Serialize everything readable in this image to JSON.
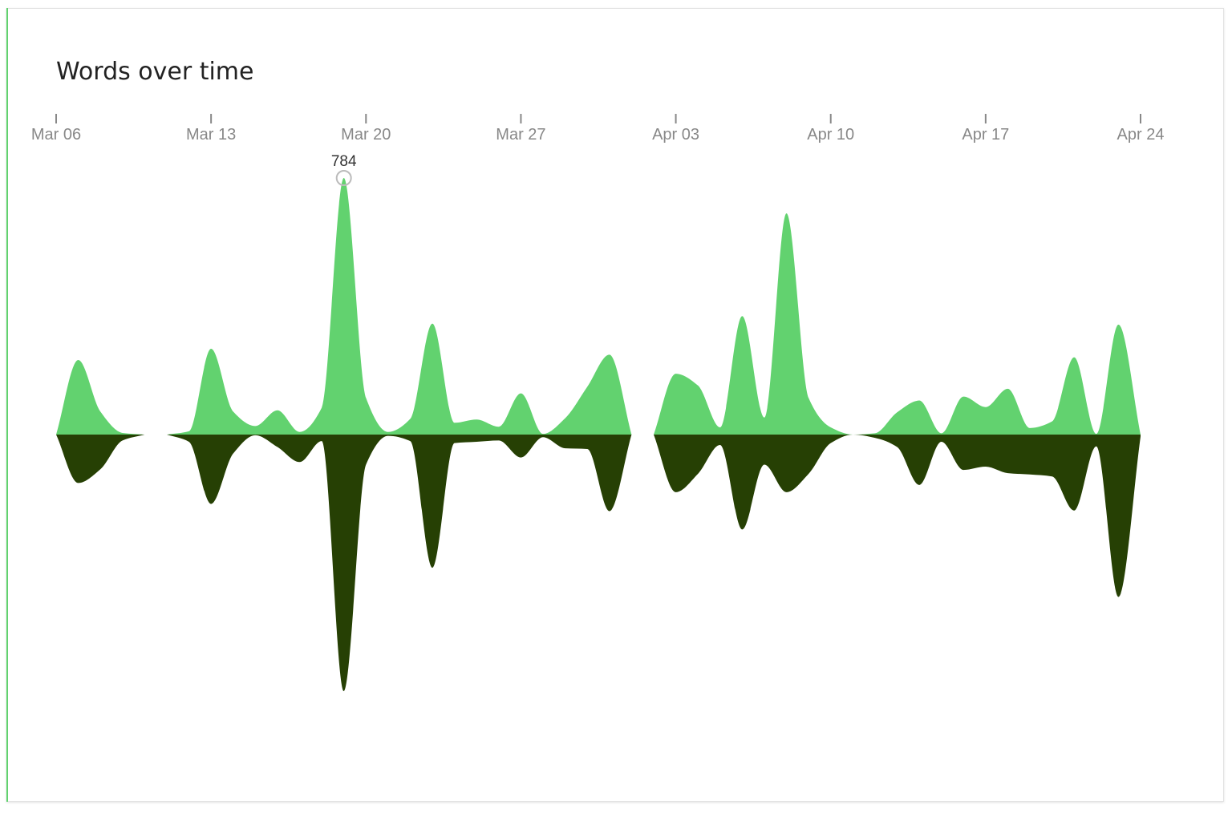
{
  "card": {
    "title": "Words over time"
  },
  "colors": {
    "upper": "#62d26f",
    "lower": "#264004",
    "tick": "#888888",
    "marker": "#bbbbbb"
  },
  "chart_data": {
    "type": "area",
    "title": "Words over time",
    "xlabel": "",
    "ylabel": "",
    "x_axis_position": "top",
    "mirrored": true,
    "grid": false,
    "legend": "none",
    "x_range": [
      "2017-03-06",
      "2017-04-24"
    ],
    "y_range": [
      -800,
      800
    ],
    "x_ticks": [
      {
        "date": "2017-03-06",
        "label": "Mar 06"
      },
      {
        "date": "2017-03-13",
        "label": "Mar 13"
      },
      {
        "date": "2017-03-20",
        "label": "Mar 20"
      },
      {
        "date": "2017-03-27",
        "label": "Mar 27"
      },
      {
        "date": "2017-04-03",
        "label": "Apr 03"
      },
      {
        "date": "2017-04-10",
        "label": "Apr 10"
      },
      {
        "date": "2017-04-17",
        "label": "Apr 17"
      },
      {
        "date": "2017-04-24",
        "label": "Apr 24"
      }
    ],
    "highlight": {
      "date": "2017-03-19",
      "value": 784,
      "label": "784"
    },
    "segments": [
      {
        "upper": [
          [
            "2017-03-06",
            0
          ],
          [
            "2017-03-07",
            228
          ],
          [
            "2017-03-08",
            70
          ],
          [
            "2017-03-09",
            5
          ],
          [
            "2017-03-10",
            0
          ]
        ],
        "lower": [
          [
            "2017-03-06",
            0
          ],
          [
            "2017-03-07",
            148
          ],
          [
            "2017-03-08",
            106
          ],
          [
            "2017-03-09",
            18
          ],
          [
            "2017-03-10",
            0
          ]
        ]
      },
      {
        "upper": [
          [
            "2017-03-11",
            0
          ],
          [
            "2017-03-12",
            10
          ],
          [
            "2017-03-13",
            262
          ],
          [
            "2017-03-14",
            70
          ],
          [
            "2017-03-15",
            26
          ],
          [
            "2017-03-16",
            74
          ],
          [
            "2017-03-17",
            8
          ],
          [
            "2017-03-18",
            82
          ],
          [
            "2017-03-19",
            784
          ],
          [
            "2017-03-20",
            112
          ],
          [
            "2017-03-21",
            8
          ],
          [
            "2017-03-22",
            48
          ],
          [
            "2017-03-23",
            339
          ],
          [
            "2017-03-24",
            36
          ],
          [
            "2017-03-25",
            46
          ],
          [
            "2017-03-26",
            24
          ],
          [
            "2017-03-27",
            126
          ],
          [
            "2017-03-28",
            2
          ],
          [
            "2017-03-29",
            50
          ],
          [
            "2017-03-30",
            146
          ],
          [
            "2017-03-31",
            244
          ],
          [
            "2017-04-01",
            0
          ]
        ],
        "lower": [
          [
            "2017-03-11",
            0
          ],
          [
            "2017-03-12",
            22
          ],
          [
            "2017-03-13",
            212
          ],
          [
            "2017-03-14",
            58
          ],
          [
            "2017-03-15",
            2
          ],
          [
            "2017-03-16",
            38
          ],
          [
            "2017-03-17",
            84
          ],
          [
            "2017-03-18",
            20
          ],
          [
            "2017-03-19",
            784
          ],
          [
            "2017-03-20",
            92
          ],
          [
            "2017-03-21",
            4
          ],
          [
            "2017-03-22",
            20
          ],
          [
            "2017-03-23",
            407
          ],
          [
            "2017-03-24",
            26
          ],
          [
            "2017-03-25",
            22
          ],
          [
            "2017-03-26",
            18
          ],
          [
            "2017-03-27",
            70
          ],
          [
            "2017-03-28",
            8
          ],
          [
            "2017-03-29",
            42
          ],
          [
            "2017-03-30",
            44
          ],
          [
            "2017-03-31",
            234
          ],
          [
            "2017-04-01",
            0
          ]
        ]
      },
      {
        "upper": [
          [
            "2017-04-02",
            0
          ],
          [
            "2017-04-03",
            186
          ],
          [
            "2017-04-04",
            150
          ],
          [
            "2017-04-05",
            22
          ],
          [
            "2017-04-06",
            362
          ],
          [
            "2017-04-07",
            52
          ],
          [
            "2017-04-08",
            676
          ],
          [
            "2017-04-09",
            112
          ],
          [
            "2017-04-10",
            22
          ],
          [
            "2017-04-11",
            0
          ],
          [
            "2017-04-12",
            4
          ],
          [
            "2017-04-13",
            68
          ],
          [
            "2017-04-14",
            104
          ],
          [
            "2017-04-15",
            4
          ],
          [
            "2017-04-16",
            116
          ],
          [
            "2017-04-17",
            84
          ],
          [
            "2017-04-18",
            140
          ],
          [
            "2017-04-19",
            20
          ],
          [
            "2017-04-20",
            40
          ],
          [
            "2017-04-21",
            236
          ],
          [
            "2017-04-22",
            2
          ],
          [
            "2017-04-23",
            336
          ],
          [
            "2017-04-24",
            0
          ]
        ],
        "lower": [
          [
            "2017-04-02",
            0
          ],
          [
            "2017-04-03",
            176
          ],
          [
            "2017-04-04",
            120
          ],
          [
            "2017-04-05",
            32
          ],
          [
            "2017-04-06",
            290
          ],
          [
            "2017-04-07",
            92
          ],
          [
            "2017-04-08",
            176
          ],
          [
            "2017-04-09",
            120
          ],
          [
            "2017-04-10",
            26
          ],
          [
            "2017-04-11",
            0
          ],
          [
            "2017-04-12",
            10
          ],
          [
            "2017-04-13",
            38
          ],
          [
            "2017-04-14",
            154
          ],
          [
            "2017-04-15",
            22
          ],
          [
            "2017-04-16",
            108
          ],
          [
            "2017-04-17",
            98
          ],
          [
            "2017-04-18",
            118
          ],
          [
            "2017-04-19",
            122
          ],
          [
            "2017-04-20",
            128
          ],
          [
            "2017-04-21",
            232
          ],
          [
            "2017-04-22",
            36
          ],
          [
            "2017-04-23",
            496
          ],
          [
            "2017-04-24",
            6
          ]
        ]
      }
    ]
  }
}
